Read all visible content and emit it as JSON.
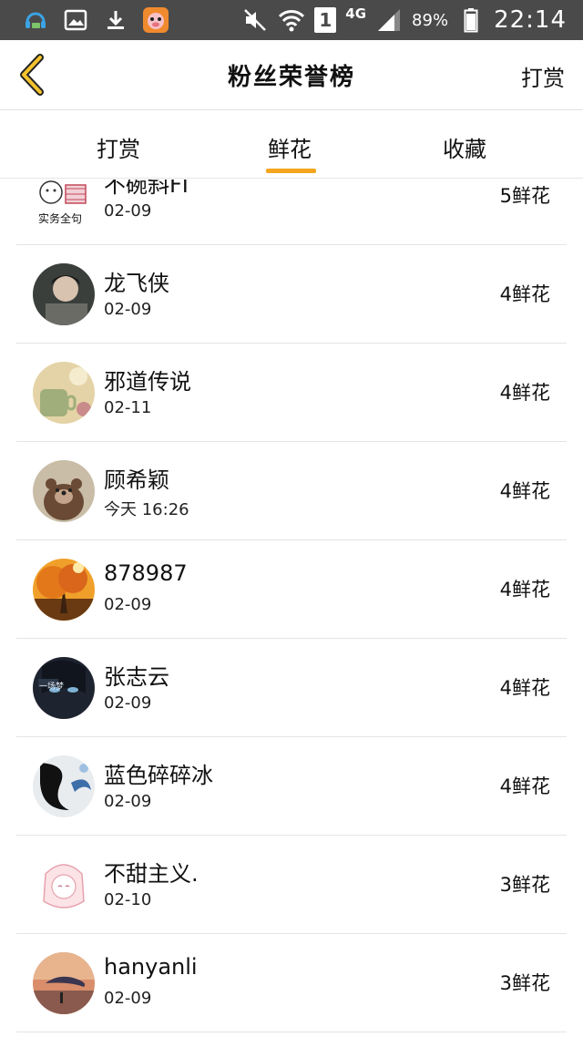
{
  "status_bar": {
    "sim_badge": "1",
    "network": "4G",
    "battery": "89%",
    "time": "22:14"
  },
  "nav": {
    "title": "粉丝荣誉榜",
    "action": "打赏"
  },
  "tabs": [
    {
      "label": "打赏",
      "active": false
    },
    {
      "label": "鲜花",
      "active": true
    },
    {
      "label": "收藏",
      "active": false
    }
  ],
  "accent_color": "#f3a61d",
  "rows": [
    {
      "name": "不碗斜FI",
      "date": "02-09",
      "count": "5鲜花",
      "avatar_label": "实务全句"
    },
    {
      "name": "龙飞侠",
      "date": "02-09",
      "count": "4鲜花"
    },
    {
      "name": "邪道传说",
      "date": "02-11",
      "count": "4鲜花"
    },
    {
      "name": "顾希颖",
      "date": "今天 16:26",
      "count": "4鲜花"
    },
    {
      "name": "878987",
      "date": "02-09",
      "count": "4鲜花"
    },
    {
      "name": "张志云",
      "date": "02-09",
      "count": "4鲜花",
      "avatar_label": "一场梦"
    },
    {
      "name": "蓝色碎碎冰",
      "date": "02-09",
      "count": "4鲜花"
    },
    {
      "name": "不甜主义.",
      "date": "02-10",
      "count": "3鲜花"
    },
    {
      "name": "hanyanli",
      "date": "02-09",
      "count": "3鲜花"
    }
  ]
}
